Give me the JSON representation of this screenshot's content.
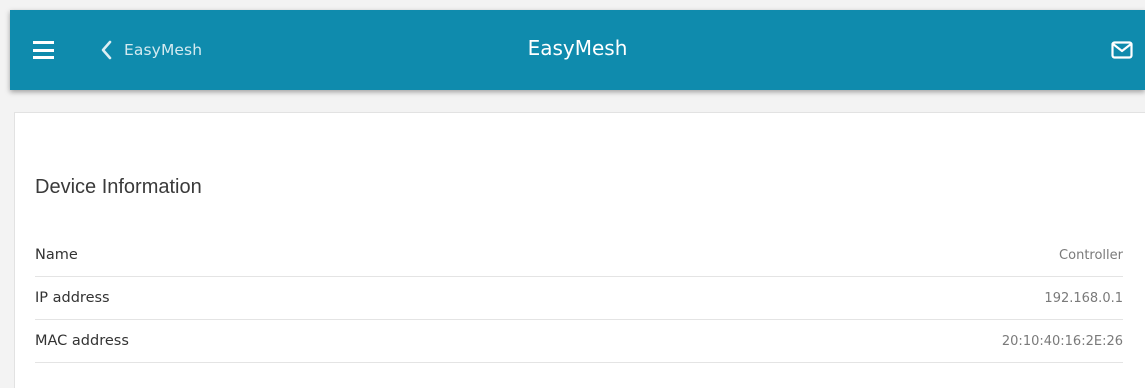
{
  "header": {
    "back_label": "EasyMesh",
    "title": "EasyMesh",
    "bg_color": "#0f8bad",
    "icons": {
      "menu": "hamburger-menu-icon",
      "back": "chevron-left-icon",
      "notifications": "mail-icon"
    }
  },
  "section": {
    "title": "Device Information",
    "rows": [
      {
        "label": "Name",
        "value": "Controller"
      },
      {
        "label": "IP address",
        "value": "192.168.0.1"
      },
      {
        "label": "MAC address",
        "value": "20:10:40:16:2E:26"
      }
    ]
  }
}
